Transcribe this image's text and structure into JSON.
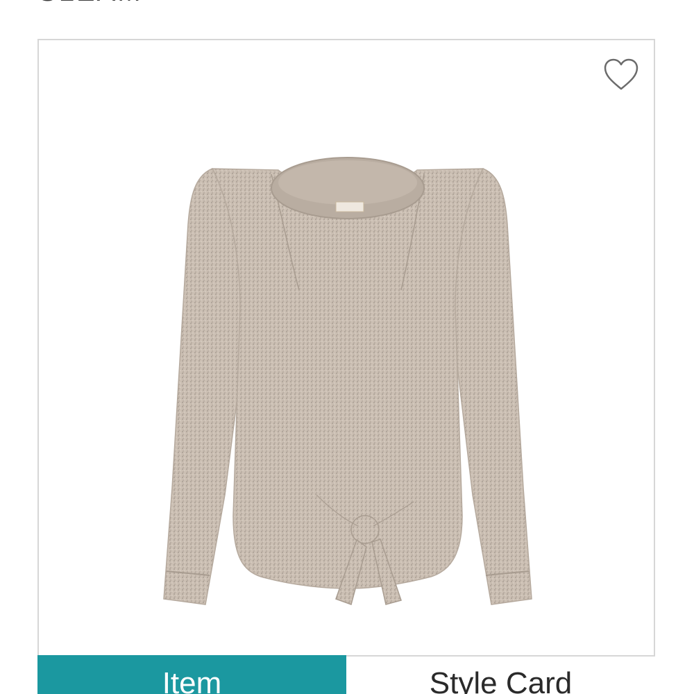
{
  "header": {
    "partial_title": "SLEAM"
  },
  "product": {
    "image_name": "tie-front-knit-long-sleeve-top",
    "favorite_icon": "heart-outline-icon"
  },
  "tabs": [
    {
      "label": "Item",
      "active": true
    },
    {
      "label": "Style Card",
      "active": false
    }
  ],
  "colors": {
    "accent": "#1b98a0",
    "border": "#d6d6d6",
    "garment": "#cbbfb3"
  }
}
